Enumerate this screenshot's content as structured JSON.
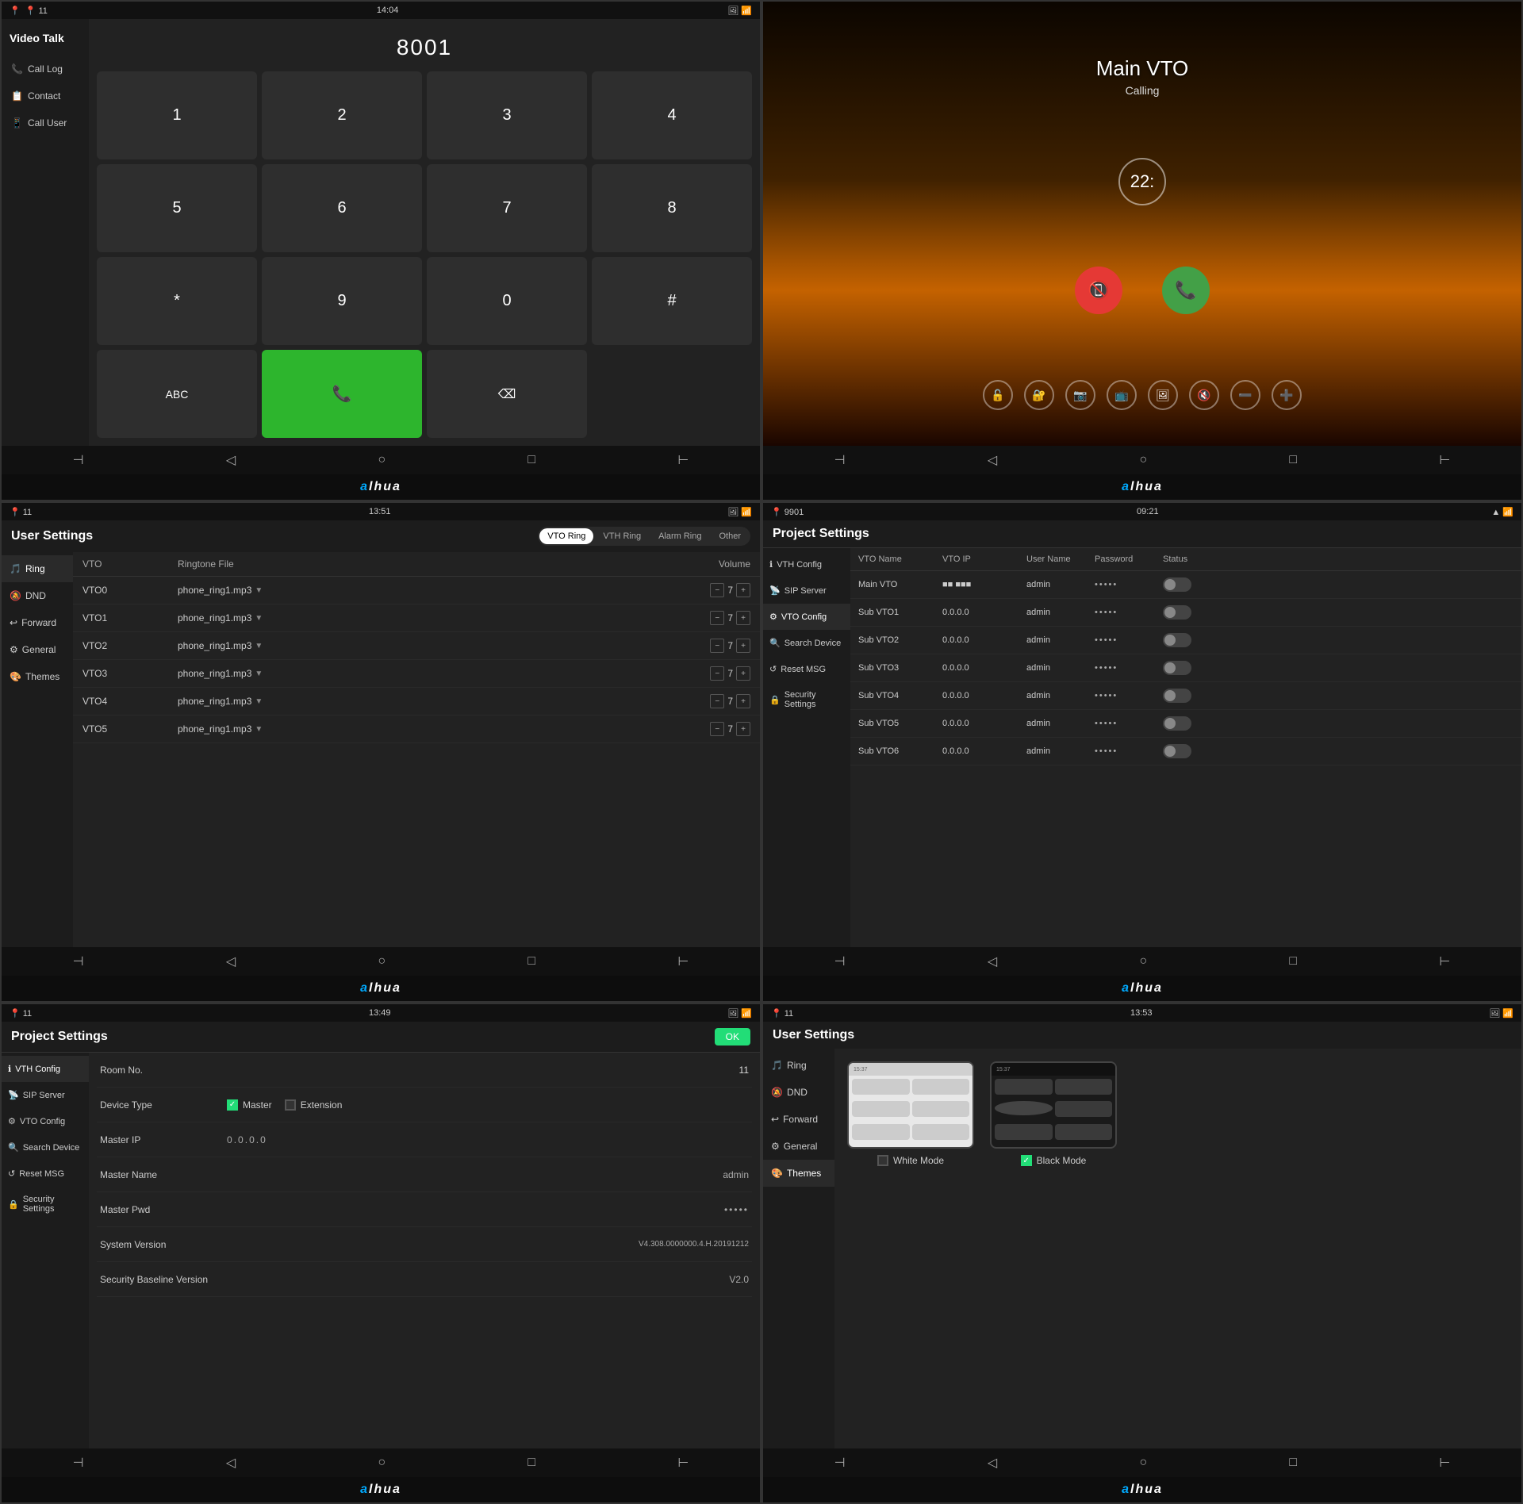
{
  "brand": "alhua",
  "panels": {
    "p1": {
      "status_bar": {
        "signal": "📍 11",
        "time": "14:04",
        "icons_right": "🖼 📶"
      },
      "sidebar": {
        "title": "Video Talk",
        "items": [
          {
            "icon": "📞",
            "label": "Call Log"
          },
          {
            "icon": "📋",
            "label": "Contact"
          },
          {
            "icon": "📱",
            "label": "Call User"
          }
        ]
      },
      "dialer": {
        "number": "8001",
        "keys": [
          "1",
          "2",
          "3",
          "4",
          "5",
          "6",
          "7",
          "8",
          "*",
          "9",
          "0",
          "#"
        ],
        "abc_label": "ABC",
        "call_icon": "📞",
        "delete_icon": "⌫"
      },
      "bottom_nav": [
        "⊣",
        "◁",
        "○",
        "□",
        "⊢"
      ]
    },
    "p2": {
      "status_bar": {
        "left": "",
        "time": "",
        "right": ""
      },
      "call": {
        "name": "Main VTO",
        "status": "Calling",
        "avatar_text": "22:",
        "decline_icon": "📵",
        "accept_icon": "📞"
      },
      "action_icons": [
        "🔓",
        "🔐",
        "📷",
        "📺",
        "🖼",
        "🔇",
        "➖",
        "➕"
      ],
      "bottom_nav": [
        "⊣",
        "◁",
        "○",
        "□",
        "⊢"
      ]
    },
    "p3": {
      "status_bar": {
        "signal": "📍 11",
        "time": "13:51",
        "icons_right": "🖼 📶"
      },
      "title": "User Settings",
      "tabs": [
        "VTO Ring",
        "VTH Ring",
        "Alarm Ring",
        "Other"
      ],
      "active_tab": "VTO Ring",
      "sidebar_items": [
        {
          "icon": "🎵",
          "label": "Ring",
          "active": true
        },
        {
          "icon": "🔕",
          "label": "DND"
        },
        {
          "icon": "↩",
          "label": "Forward"
        },
        {
          "icon": "⚙",
          "label": "General"
        },
        {
          "icon": "🎨",
          "label": "Themes"
        }
      ],
      "table_header": [
        "VTO",
        "Ringtone File",
        "Volume"
      ],
      "rows": [
        {
          "vto": "VTO0",
          "file": "phone_ring1.mp3",
          "volume": "7"
        },
        {
          "vto": "VTO1",
          "file": "phone_ring1.mp3",
          "volume": "7"
        },
        {
          "vto": "VTO2",
          "file": "phone_ring1.mp3",
          "volume": "7"
        },
        {
          "vto": "VTO3",
          "file": "phone_ring1.mp3",
          "volume": "7"
        },
        {
          "vto": "VTO4",
          "file": "phone_ring1.mp3",
          "volume": "7"
        },
        {
          "vto": "VTO5",
          "file": "phone_ring1.mp3",
          "volume": "7"
        }
      ],
      "bottom_nav": [
        "⊣",
        "◁",
        "○",
        "□",
        "⊢"
      ]
    },
    "p4": {
      "status_bar": {
        "signal": "📍 9901",
        "time": "09:21",
        "icons_right": "▲ 📶"
      },
      "title": "Project Settings",
      "sidebar_items": [
        {
          "icon": "ℹ",
          "label": "VTH Config"
        },
        {
          "icon": "📡",
          "label": "SIP Server"
        },
        {
          "icon": "⚙",
          "label": "VTO Config",
          "active": true
        },
        {
          "icon": "🔍",
          "label": "Search Device"
        },
        {
          "icon": "↺",
          "label": "Reset MSG"
        },
        {
          "icon": "🔒",
          "label": "Security Settings"
        }
      ],
      "table_header": [
        "VTO Name",
        "VTO IP",
        "User Name",
        "Password",
        "Status"
      ],
      "rows": [
        {
          "name": "Main VTO",
          "ip": "■■■ ■■■",
          "user": "admin",
          "pwd": "•••••",
          "status": false
        },
        {
          "name": "Sub VTO1",
          "ip": "0.0.0.0",
          "user": "admin",
          "pwd": "•••••",
          "status": false
        },
        {
          "name": "Sub VTO2",
          "ip": "0.0.0.0",
          "user": "admin",
          "pwd": "•••••",
          "status": false
        },
        {
          "name": "Sub VTO3",
          "ip": "0.0.0.0",
          "user": "admin",
          "pwd": "•••••",
          "status": false
        },
        {
          "name": "Sub VTO4",
          "ip": "0.0.0.0",
          "user": "admin",
          "pwd": "•••••",
          "status": false
        },
        {
          "name": "Sub VTO5",
          "ip": "0.0.0.0",
          "user": "admin",
          "pwd": "•••••",
          "status": false
        },
        {
          "name": "Sub VTO6",
          "ip": "0.0.0.0",
          "user": "admin",
          "pwd": "•••••",
          "status": false
        }
      ],
      "bottom_nav": [
        "⊣",
        "◁",
        "○",
        "□",
        "⊢"
      ]
    },
    "p5": {
      "status_bar": {
        "signal": "📍 11",
        "time": "13:49",
        "icons_right": "🖼 📶"
      },
      "title": "Project Settings",
      "ok_label": "OK",
      "sidebar_items": [
        {
          "icon": "ℹ",
          "label": "VTH Config",
          "active": true
        },
        {
          "icon": "📡",
          "label": "SIP Server"
        },
        {
          "icon": "⚙",
          "label": "VTO Config"
        },
        {
          "icon": "🔍",
          "label": "Search Device"
        },
        {
          "icon": "↺",
          "label": "Reset MSG"
        },
        {
          "icon": "🔒",
          "label": "Security Settings"
        }
      ],
      "fields": [
        {
          "label": "Room No.",
          "value": "11"
        },
        {
          "label": "Device Type",
          "type": "checkbox"
        },
        {
          "label": "Master IP",
          "type": "ip"
        },
        {
          "label": "Master Name",
          "value": "admin"
        },
        {
          "label": "Master Pwd",
          "value": "•••••"
        },
        {
          "label": "System Version",
          "value": "V4.308.0000000.4.H.20191212"
        },
        {
          "label": "Security Baseline Version",
          "value": "V2.0"
        }
      ],
      "device_type": {
        "master_checked": true,
        "extension_checked": false,
        "master_label": "Master",
        "extension_label": "Extension"
      },
      "bottom_nav": [
        "⊣",
        "◁",
        "○",
        "□",
        "⊢"
      ]
    },
    "p6": {
      "status_bar": {
        "signal": "📍 11",
        "time": "13:53",
        "icons_right": "🖼 📶"
      },
      "title": "User Settings",
      "sidebar_items": [
        {
          "icon": "🎵",
          "label": "Ring"
        },
        {
          "icon": "🔕",
          "label": "DND"
        },
        {
          "icon": "↩",
          "label": "Forward"
        },
        {
          "icon": "⚙",
          "label": "General"
        },
        {
          "icon": "🎨",
          "label": "Themes",
          "active": true
        }
      ],
      "themes": [
        {
          "name": "White Mode",
          "checked": false,
          "type": "white"
        },
        {
          "name": "Black Mode",
          "checked": true,
          "type": "black"
        }
      ],
      "bottom_nav": [
        "⊣",
        "◁",
        "○",
        "□",
        "⊢"
      ]
    }
  }
}
